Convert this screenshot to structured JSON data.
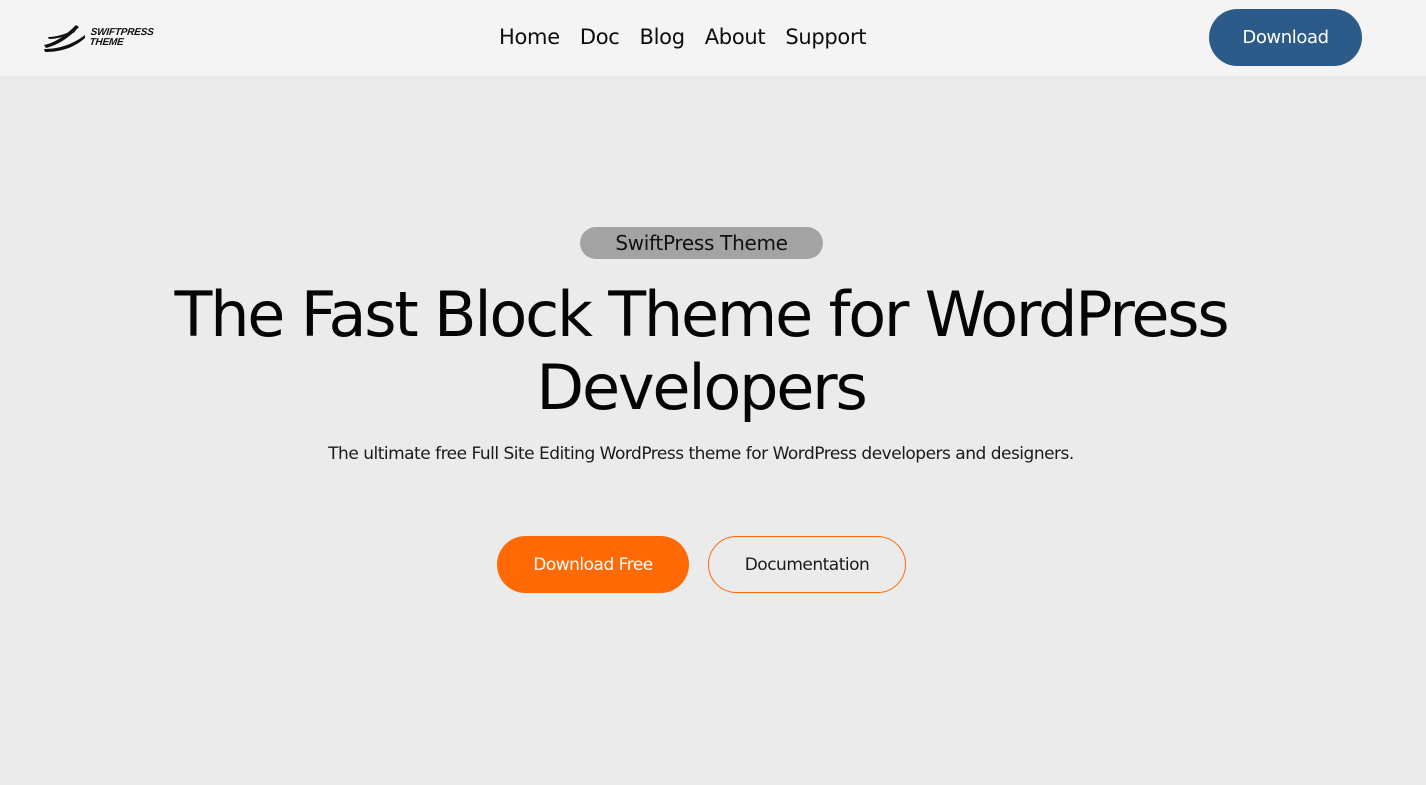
{
  "header": {
    "logo": {
      "line1": "SWIFTPRESS",
      "line2": "THEME",
      "icon": "swoosh-logo-icon"
    },
    "nav": [
      {
        "label": "Home"
      },
      {
        "label": "Doc"
      },
      {
        "label": "Blog"
      },
      {
        "label": "About"
      },
      {
        "label": "Support"
      }
    ],
    "download_label": "Download"
  },
  "hero": {
    "badge": "SwiftPress Theme",
    "headline": "The Fast Block Theme for WordPress Developers",
    "subtext": "The ultimate free Full Site Editing WordPress theme for WordPress developers and designers.",
    "primary_button": "Download Free",
    "secondary_button": "Documentation"
  },
  "colors": {
    "page_background": "#ebebeb",
    "header_background": "#f4f4f4",
    "header_button": "#2c5b8a",
    "accent_orange": "#ff6a06",
    "badge_background": "#a3a3a3"
  }
}
